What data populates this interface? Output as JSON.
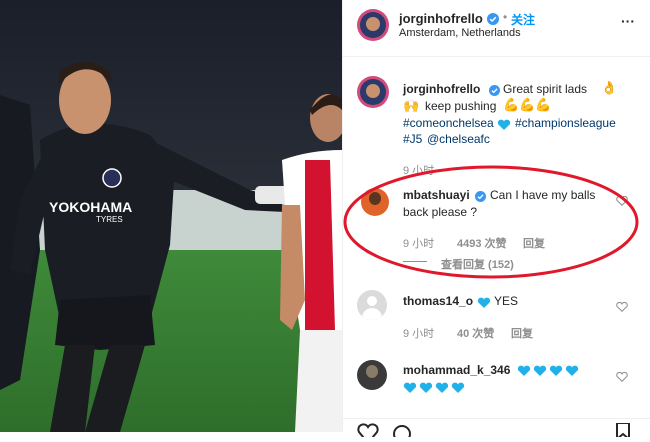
{
  "post_header": {
    "username": "jorginhofrello",
    "follow_label": "关注",
    "location": "Amsterdam, Netherlands",
    "more": "···"
  },
  "caption": {
    "username": "jorginhofrello",
    "line1": "Great spirit lads",
    "line2": "keep pushing",
    "tag1": "#comeonchelsea",
    "tag2": "#championsleague",
    "tag3": "#J5",
    "mention": "@chelseafc",
    "time": "9 小时"
  },
  "comments": [
    {
      "username": "mbatshuayi",
      "text_line1": "Can I have my balls",
      "text_line2": "back please ?",
      "time": "9 小时",
      "likes": "4493 次赞",
      "reply": "回复",
      "view_replies": "查看回复 (152)"
    },
    {
      "username": "thomas14_o",
      "text": "YES",
      "time": "9 小时",
      "likes": "40 次赞",
      "reply": "回复"
    },
    {
      "username": "mohammad_k_346",
      "text": ""
    }
  ],
  "colors": {
    "accent_blue": "#0095f6",
    "highlight_red": "#e0182b",
    "heart_blue": "#1fb1e8"
  },
  "photo_text": {
    "sponsor": "YOKOHAMA",
    "sponsor_sub": "TYRES"
  }
}
